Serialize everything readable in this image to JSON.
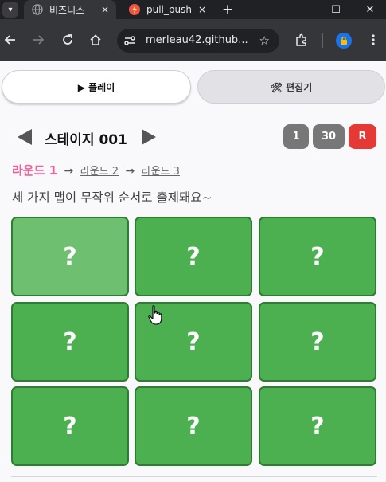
{
  "browser": {
    "tabs": [
      {
        "title": "비즈니스",
        "active": true
      },
      {
        "title": "pull_push",
        "active": false
      }
    ],
    "tab_close_glyph": "×",
    "new_tab_glyph": "+",
    "url": "merleau42.github...",
    "window_controls": {
      "minimize": "–",
      "maximize": "☐",
      "close": "✕"
    }
  },
  "mode_buttons": {
    "play_label": "▶ 플레이",
    "editor_label": "🛠 편집기"
  },
  "stage": {
    "title": "스테이지 001",
    "pills": [
      "1",
      "30",
      "R"
    ]
  },
  "rounds": {
    "current": "라운드 1",
    "separator": "→",
    "others": [
      "라운드 2",
      "라운드 3"
    ]
  },
  "description": "세 가지 맵이 무작위 순서로 출제돼요~",
  "grid": {
    "cells": [
      "?",
      "?",
      "?",
      "?",
      "?",
      "?",
      "?",
      "?",
      "?"
    ]
  },
  "colors": {
    "cell": "#4caf50",
    "cell_highlight": "#6ec070",
    "cell_border": "#2e7d32",
    "round_current": "#f0609b",
    "reset_pill": "#e53935",
    "grey_pill": "#777777"
  }
}
